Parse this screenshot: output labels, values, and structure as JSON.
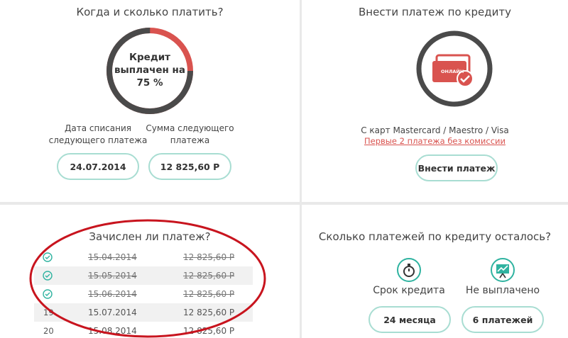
{
  "when": {
    "title": "Когда и сколько платить?",
    "progress_text_1": "Кредит",
    "progress_text_2": "выплачен на",
    "progress_text_3": "75 %",
    "progress_fraction": 0.75,
    "colors": {
      "ring_done": "#4a4a4a",
      "ring_rest": "#d9534f"
    },
    "date_label_1": "Дата списания",
    "date_label_2": "следующего платежа",
    "sum_label_1": "Сумма следующего",
    "sum_label_2": "платежа",
    "date_value": "24.07.2014",
    "sum_value": "12 825,60 Р"
  },
  "pay": {
    "title": "Внести платеж по кредиту",
    "icon_text": "ОНЛАЙН",
    "cards_text": "С карт Mastercard / Maestro / Visa",
    "commission_link": "Первые 2 платежа без комиссии",
    "button_label": "Внести платеж"
  },
  "paid": {
    "title": "Зачислен ли платеж?",
    "rows": [
      {
        "num": "",
        "date": "15.04.2014",
        "sum": "12 825,60 Р",
        "done": true
      },
      {
        "num": "",
        "date": "15.05.2014",
        "sum": "12 825,60 Р",
        "done": true
      },
      {
        "num": "",
        "date": "15.06.2014",
        "sum": "12 825,60 Р",
        "done": true
      },
      {
        "num": "19",
        "date": "15.07.2014",
        "sum": "12 825,60 Р",
        "done": false
      },
      {
        "num": "20",
        "date": "15.08.2014",
        "sum": "12 825,60 Р",
        "done": false
      }
    ]
  },
  "remaining": {
    "title": "Сколько платежей по кредиту осталось?",
    "term_label": "Срок кредита",
    "unpaid_label": "Не выплачено",
    "term_value": "24 месяца",
    "unpaid_value": "6 платежей"
  }
}
